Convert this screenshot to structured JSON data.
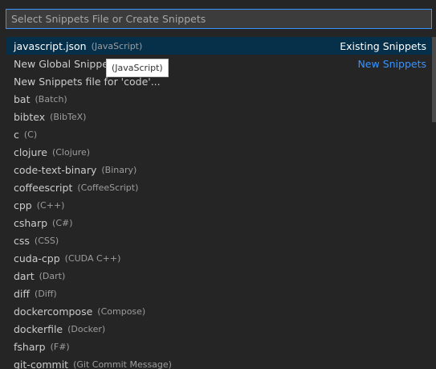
{
  "search": {
    "placeholder": "Select Snippets File or Create Snippets",
    "value": ""
  },
  "items": [
    {
      "label": "javascript.json",
      "description": "(JavaScript)",
      "detail": "Existing Snippets",
      "selected": true
    },
    {
      "label": "New Global Snippets file...",
      "description": "",
      "detail": "New Snippets",
      "selected": false
    },
    {
      "label": "New Snippets file for 'code'...",
      "description": "",
      "detail": "",
      "selected": false
    },
    {
      "label": "bat",
      "description": "(Batch)",
      "detail": "",
      "selected": false
    },
    {
      "label": "bibtex",
      "description": "(BibTeX)",
      "detail": "",
      "selected": false
    },
    {
      "label": "c",
      "description": "(C)",
      "detail": "",
      "selected": false
    },
    {
      "label": "clojure",
      "description": "(Clojure)",
      "detail": "",
      "selected": false
    },
    {
      "label": "code-text-binary",
      "description": "(Binary)",
      "detail": "",
      "selected": false
    },
    {
      "label": "coffeescript",
      "description": "(CoffeeScript)",
      "detail": "",
      "selected": false
    },
    {
      "label": "cpp",
      "description": "(C++)",
      "detail": "",
      "selected": false
    },
    {
      "label": "csharp",
      "description": "(C#)",
      "detail": "",
      "selected": false
    },
    {
      "label": "css",
      "description": "(CSS)",
      "detail": "",
      "selected": false
    },
    {
      "label": "cuda-cpp",
      "description": "(CUDA C++)",
      "detail": "",
      "selected": false
    },
    {
      "label": "dart",
      "description": "(Dart)",
      "detail": "",
      "selected": false
    },
    {
      "label": "diff",
      "description": "(Diff)",
      "detail": "",
      "selected": false
    },
    {
      "label": "dockercompose",
      "description": "(Compose)",
      "detail": "",
      "selected": false
    },
    {
      "label": "dockerfile",
      "description": "(Docker)",
      "detail": "",
      "selected": false
    },
    {
      "label": "fsharp",
      "description": "(F#)",
      "detail": "",
      "selected": false
    },
    {
      "label": "git-commit",
      "description": "(Git Commit Message)",
      "detail": "",
      "selected": false
    }
  ],
  "tooltip": {
    "text": "(JavaScript)"
  },
  "colors": {
    "background": "#252526",
    "selection": "#062f4a",
    "focus_border": "#3794ff",
    "link": "#3794ff"
  }
}
